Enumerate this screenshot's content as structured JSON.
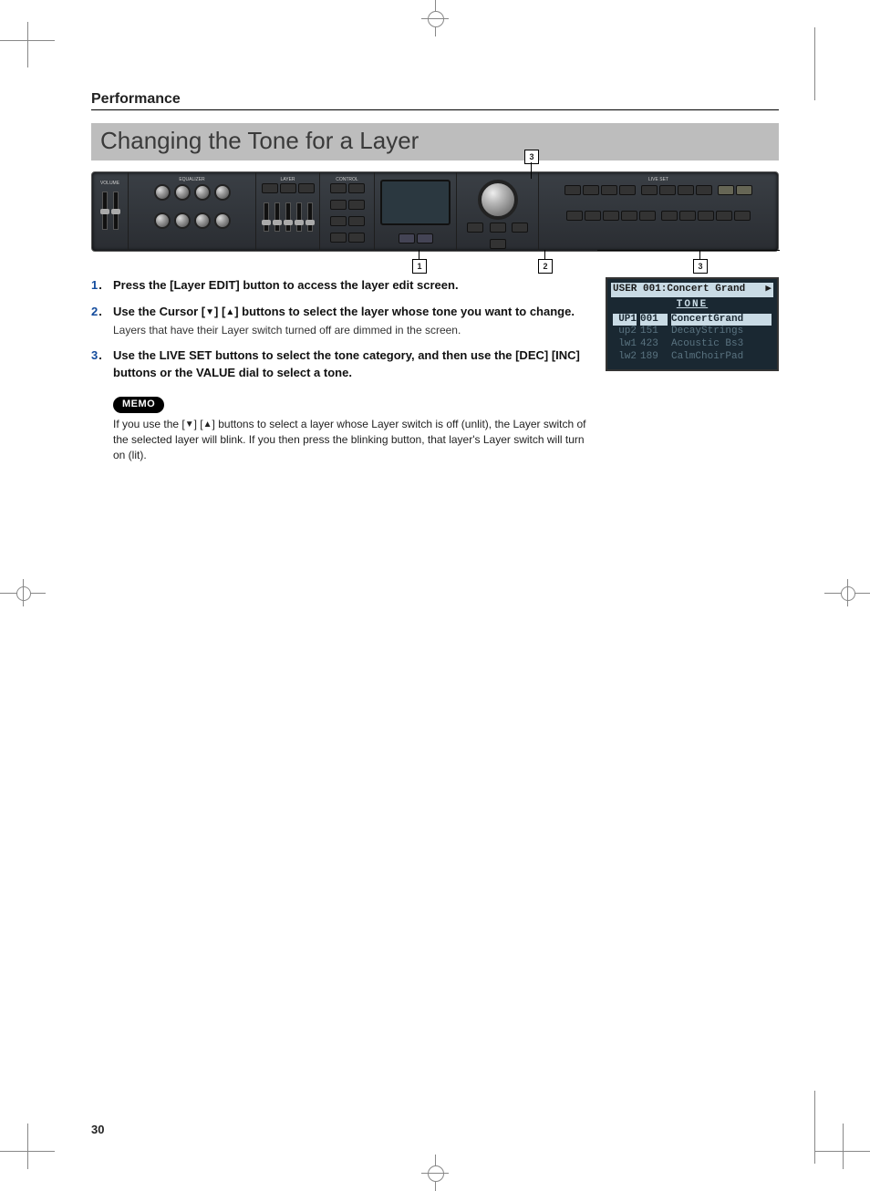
{
  "page": {
    "section_label": "Performance",
    "title": "Changing the Tone for a Layer",
    "number": "30"
  },
  "callouts": {
    "a": "3",
    "b": "1",
    "c": "2",
    "d": "3"
  },
  "instructions": [
    {
      "num": "1",
      "main": "Press the [Layer EDIT] button to access the layer edit screen.",
      "sub": ""
    },
    {
      "num": "2",
      "main_pre": "Use the Cursor [",
      "main_mid": "] [",
      "main_post": "] buttons to select the layer whose tone you want to change.",
      "sub": "Layers that have their Layer switch turned off are dimmed in the screen."
    },
    {
      "num": "3",
      "main": "Use the LIVE SET buttons to select the tone category, and then use the [DEC] [INC] buttons or the VALUE dial to select a tone.",
      "sub": ""
    }
  ],
  "memo": {
    "label": "MEMO",
    "text_pre": "If you use the [",
    "text_mid": "] [",
    "text_post": "] buttons to select a layer whose Layer switch is off (unlit), the Layer switch of the selected layer will blink. If you then press the blinking button, that layer's Layer switch will turn on (lit)."
  },
  "lcd": {
    "title": "USER 001:Concert Grand",
    "arrow": "▶",
    "sub": "TONE",
    "rows": [
      {
        "tag": "UP1",
        "num": "001",
        "name": "ConcertGrand",
        "style": "sel"
      },
      {
        "tag": "up2",
        "num": "151",
        "name": "DecayStrings",
        "style": "dim"
      },
      {
        "tag": "lw1",
        "num": "423",
        "name": "Acoustic Bs3",
        "style": "dim"
      },
      {
        "tag": "lw2",
        "num": "189",
        "name": "CalmChoirPad",
        "style": "dim"
      }
    ]
  }
}
